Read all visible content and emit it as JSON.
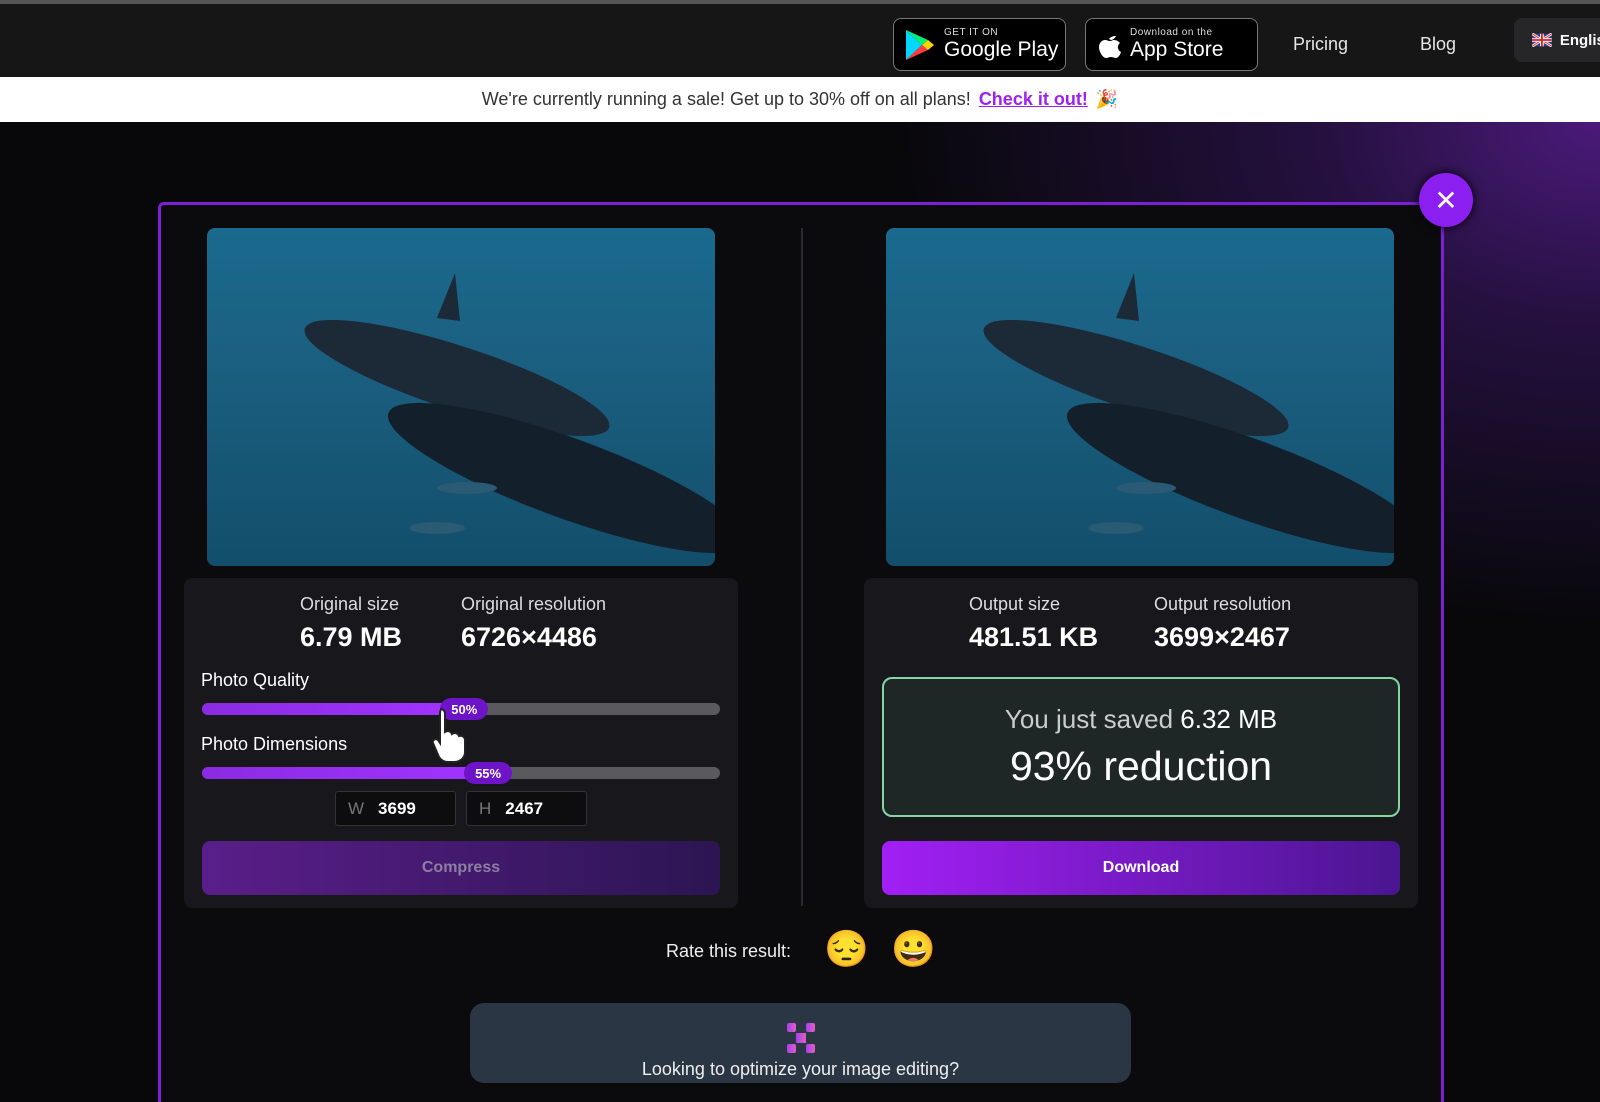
{
  "topbar": {
    "google_play": {
      "small": "GET IT ON",
      "big": "Google Play"
    },
    "app_store": {
      "small": "Download on the",
      "big": "App Store"
    },
    "nav": [
      "Pricing",
      "Blog"
    ],
    "language": "English"
  },
  "banner": {
    "text": "We're currently running a sale! Get up to 30% off on all plans!",
    "link": "Check it out!",
    "emoji": "🎉"
  },
  "original": {
    "size_label": "Original size",
    "size": "6.79 MB",
    "res_label": "Original resolution",
    "res": "6726×4486"
  },
  "output": {
    "size_label": "Output size",
    "size": "481.51 KB",
    "res_label": "Output resolution",
    "res": "3699×2467"
  },
  "quality": {
    "label": "Photo Quality",
    "value": "50%",
    "percent": 50
  },
  "dimensions": {
    "label": "Photo Dimensions",
    "value": "55%",
    "percent": 55,
    "w_label": "W",
    "w": "3699",
    "h_label": "H",
    "h": "2467"
  },
  "compress_label": "Compress",
  "saved": {
    "prefix": "You just saved",
    "amount": "6.32 MB",
    "reduction": "93% reduction"
  },
  "download_label": "Download",
  "rate": {
    "label": "Rate this result:",
    "bad": "😔",
    "good": "😀"
  },
  "card": {
    "text": "Looking to optimize your image editing?"
  },
  "colors": {
    "accent": "#8a1ff0",
    "saved_border": "#86d4a2"
  }
}
